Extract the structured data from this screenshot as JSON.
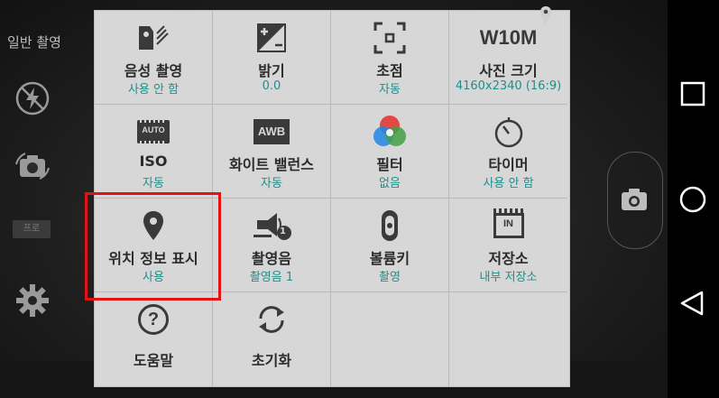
{
  "left_bar": {
    "mode_label": "일반 촬영",
    "wide_label": "프로"
  },
  "settings": [
    {
      "title": "음성 촬영",
      "value": "사용 안 함",
      "icon": "voice-shutter-icon"
    },
    {
      "title": "밝기",
      "value": "0.0",
      "icon": "exposure-icon"
    },
    {
      "title": "초점",
      "value": "자동",
      "icon": "focus-icon"
    },
    {
      "title": "사진 크기",
      "value": "4160x2340 (16:9)",
      "icon": "w10m-icon",
      "icon_text": "W10M"
    },
    {
      "title": "ISO",
      "value": "자동",
      "icon": "iso-icon",
      "icon_text": "AUTO"
    },
    {
      "title": "화이트 밸런스",
      "value": "자동",
      "icon": "white-balance-icon",
      "icon_text": "AWB"
    },
    {
      "title": "필터",
      "value": "없음",
      "icon": "color-filter-icon"
    },
    {
      "title": "타이머",
      "value": "사용 안 함",
      "icon": "timer-icon"
    },
    {
      "title": "위치 정보 표시",
      "value": "사용",
      "icon": "location-pin-icon"
    },
    {
      "title": "촬영음",
      "value": "촬영음 1",
      "icon": "shutter-sound-icon",
      "icon_text": "1"
    },
    {
      "title": "볼륨키",
      "value": "촬영",
      "icon": "volume-key-icon"
    },
    {
      "title": "저장소",
      "value": "내부 저장소",
      "icon": "storage-icon",
      "icon_text": "IN"
    },
    {
      "title": "도움말",
      "icon": "help-icon",
      "icon_text": "?"
    },
    {
      "title": "초기화",
      "icon": "reset-icon"
    }
  ],
  "colors": {
    "panel_bg": "#d7d7d7",
    "value_teal": "#1e8f8a",
    "highlight_red": "#e01414"
  }
}
